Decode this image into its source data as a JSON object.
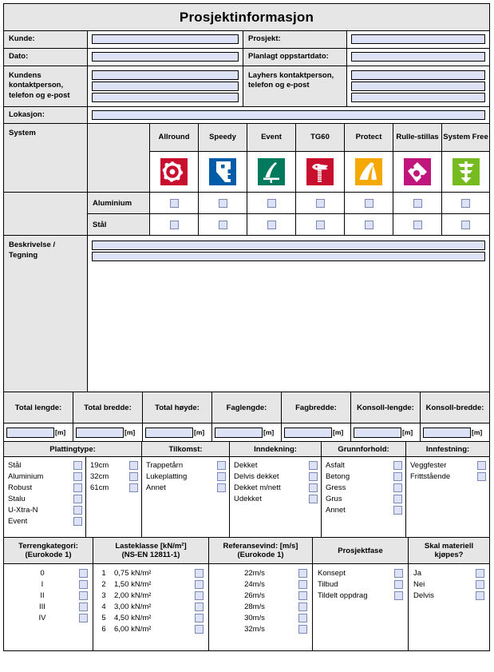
{
  "title": "Prosjektinformasjon",
  "contact": {
    "kunde_label": "Kunde:",
    "prosjekt_label": "Prosjekt:",
    "dato_label": "Dato:",
    "oppstart_label": "Planlagt oppstartdato:",
    "kundens_kontakt_label": "Kundens kontaktperson, telefon og e-post",
    "layhers_kontakt_label": "Layhers kontaktperson, telefon og e-post",
    "lokasjon_label": "Lokasjon:",
    "kunde_value": "",
    "prosjekt_value": "",
    "dato_value": "",
    "oppstart_value": "",
    "lokasjon_value": ""
  },
  "system": {
    "label": "System",
    "columns": [
      {
        "name": "Allround",
        "icon": "allround-icon",
        "color": "#c8102e"
      },
      {
        "name": "Speedy",
        "icon": "speedy-icon",
        "color": "#005ca9"
      },
      {
        "name": "Event",
        "icon": "event-icon",
        "color": "#00795c"
      },
      {
        "name": "TG60",
        "icon": "tg60-icon",
        "color": "#c8102e"
      },
      {
        "name": "Protect",
        "icon": "protect-icon",
        "color": "#f5a800"
      },
      {
        "name": "Rulle-stillas",
        "icon": "rullestillas-icon",
        "color": "#c1157e"
      },
      {
        "name": "System Free",
        "icon": "systemfree-icon",
        "color": "#76bc21"
      }
    ],
    "rows": [
      {
        "label": "Aluminium",
        "checks": [
          false,
          false,
          false,
          false,
          false,
          false,
          false
        ]
      },
      {
        "label": "Stål",
        "checks": [
          false,
          false,
          false,
          false,
          false,
          false,
          false
        ]
      }
    ]
  },
  "description": {
    "label": "Beskrivelse / Tegning",
    "line1": "",
    "line2": ""
  },
  "dimensions": {
    "unit": "[m]",
    "items": [
      {
        "label": "Total lengde:",
        "value": ""
      },
      {
        "label": "Total bredde:",
        "value": ""
      },
      {
        "label": "Total høyde:",
        "value": ""
      },
      {
        "label": "Faglengde:",
        "value": ""
      },
      {
        "label": "Fagbredde:",
        "value": ""
      },
      {
        "label": "Konsoll-lengde:",
        "value": ""
      },
      {
        "label": "Konsoll-bredde:",
        "value": ""
      }
    ]
  },
  "options": {
    "plattingtype": {
      "header": "Plattingtype:",
      "col1": [
        {
          "label": "Stål",
          "checked": false
        },
        {
          "label": "Aluminium",
          "checked": false
        },
        {
          "label": "Robust",
          "checked": false
        },
        {
          "label": "Stalu",
          "checked": false
        },
        {
          "label": "U-Xtra-N",
          "checked": false
        },
        {
          "label": "Event",
          "checked": false
        }
      ],
      "col2": [
        {
          "label": "19cm",
          "checked": false
        },
        {
          "label": "32cm",
          "checked": false
        },
        {
          "label": "61cm",
          "checked": false
        }
      ]
    },
    "tilkomst": {
      "header": "Tilkomst:",
      "items": [
        {
          "label": "Trappetårn",
          "checked": false
        },
        {
          "label": "Lukeplatting",
          "checked": false
        },
        {
          "label": "Annet",
          "checked": false
        }
      ]
    },
    "inndekning": {
      "header": "Inndekning:",
      "items": [
        {
          "label": "Dekket",
          "checked": false
        },
        {
          "label": "Delvis dekket",
          "checked": false
        },
        {
          "label": "Dekket m/nett",
          "checked": false
        },
        {
          "label": "Udekket",
          "checked": false
        }
      ]
    },
    "grunnforhold": {
      "header": "Grunnforhold:",
      "items": [
        {
          "label": "Asfalt",
          "checked": false
        },
        {
          "label": "Betong",
          "checked": false
        },
        {
          "label": "Gress",
          "checked": false
        },
        {
          "label": "Grus",
          "checked": false
        },
        {
          "label": "Annet",
          "checked": false
        }
      ]
    },
    "innfestning": {
      "header": "Innfestning:",
      "items": [
        {
          "label": "Veggfester",
          "checked": false
        },
        {
          "label": "Frittstående",
          "checked": false
        }
      ]
    }
  },
  "bottom": {
    "terrengkategori": {
      "header_line1": "Terrengkategori:",
      "header_line2": "(Eurokode 1)",
      "items": [
        {
          "label": "0",
          "checked": false
        },
        {
          "label": "I",
          "checked": false
        },
        {
          "label": "II",
          "checked": false
        },
        {
          "label": "III",
          "checked": false
        },
        {
          "label": "IV",
          "checked": false
        }
      ]
    },
    "lasteklasse": {
      "header_line1": "Lasteklasse [kN/m²]",
      "header_line2": "(NS-EN 12811-1)",
      "items": [
        {
          "num": "1",
          "value": "0,75 kN/m²",
          "checked": false
        },
        {
          "num": "2",
          "value": "1,50 kN/m²",
          "checked": false
        },
        {
          "num": "3",
          "value": "2,00 kN/m²",
          "checked": false
        },
        {
          "num": "4",
          "value": "3,00 kN/m²",
          "checked": false
        },
        {
          "num": "5",
          "value": "4,50 kN/m²",
          "checked": false
        },
        {
          "num": "6",
          "value": "6,00 kN/m²",
          "checked": false
        }
      ]
    },
    "referansevind": {
      "header_line1": "Referansevind: [m/s]",
      "header_line2": "(Eurokode 1)",
      "items": [
        {
          "label": "22m/s",
          "checked": false
        },
        {
          "label": "24m/s",
          "checked": false
        },
        {
          "label": "26m/s",
          "checked": false
        },
        {
          "label": "28m/s",
          "checked": false
        },
        {
          "label": "30m/s",
          "checked": false
        },
        {
          "label": "32m/s",
          "checked": false
        }
      ]
    },
    "prosjektfase": {
      "header": "Prosjektfase",
      "items": [
        {
          "label": "Konsept",
          "checked": false
        },
        {
          "label": "Tilbud",
          "checked": false
        },
        {
          "label": "Tildelt oppdrag",
          "checked": false
        }
      ]
    },
    "materiell": {
      "header_line1": "Skal materiell",
      "header_line2": "kjøpes?",
      "items": [
        {
          "label": "Ja",
          "checked": false
        },
        {
          "label": "Nei",
          "checked": false
        },
        {
          "label": "Delvis",
          "checked": false
        }
      ]
    }
  },
  "colors": {
    "header_bg": "#e6e6e6",
    "field_fill": "#dde2f7",
    "checkbox_fill": "#dde2f7",
    "checkbox_border": "#7b8ab5",
    "border": "#000000"
  }
}
